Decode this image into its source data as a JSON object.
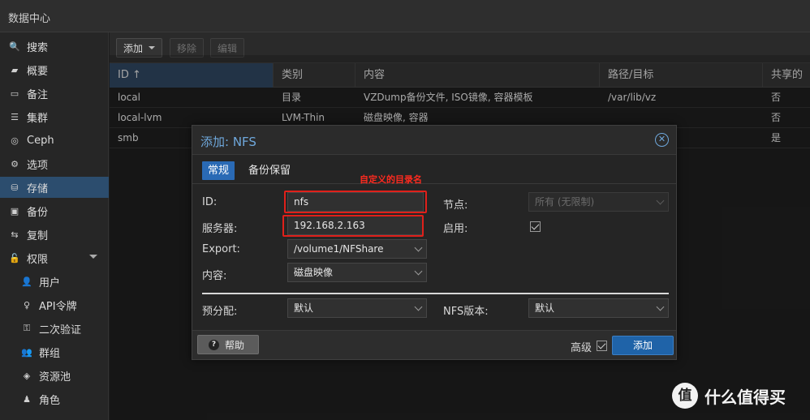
{
  "topbar": {
    "title": "数据中心"
  },
  "sidebar": {
    "items": [
      {
        "label": "搜索",
        "icon": "search-icon",
        "glyph": "🔍"
      },
      {
        "label": "概要",
        "icon": "book-icon",
        "glyph": "▰"
      },
      {
        "label": "备注",
        "icon": "note-icon",
        "glyph": "▭"
      },
      {
        "label": "集群",
        "icon": "server-icon",
        "glyph": "☰"
      },
      {
        "label": "Ceph",
        "icon": "ceph-icon",
        "glyph": "◎"
      },
      {
        "label": "选项",
        "icon": "gear-icon",
        "glyph": "⚙"
      },
      {
        "label": "存储",
        "icon": "database-icon",
        "glyph": "⛁"
      },
      {
        "label": "备份",
        "icon": "floppy-icon",
        "glyph": "▣"
      },
      {
        "label": "复制",
        "icon": "retweet-icon",
        "glyph": "⇆"
      },
      {
        "label": "权限",
        "icon": "unlock-icon",
        "glyph": "🔓"
      },
      {
        "label": "用户",
        "icon": "user-icon",
        "glyph": "👤"
      },
      {
        "label": "API令牌",
        "icon": "token-icon",
        "glyph": "♀"
      },
      {
        "label": "二次验证",
        "icon": "key-icon",
        "glyph": "⚿"
      },
      {
        "label": "群组",
        "icon": "group-icon",
        "glyph": "👥"
      },
      {
        "label": "资源池",
        "icon": "tags-icon",
        "glyph": "◈"
      },
      {
        "label": "角色",
        "icon": "person-icon",
        "glyph": "♟"
      }
    ]
  },
  "toolbar": {
    "add": "添加",
    "remove": "移除",
    "edit": "编辑"
  },
  "grid": {
    "columns": [
      "ID ↑",
      "类别",
      "内容",
      "路径/目标",
      "共享的"
    ],
    "rows": [
      [
        "local",
        "目录",
        "VZDump备份文件, ISO镜像, 容器模板",
        "/var/lib/vz",
        "否"
      ],
      [
        "local-lvm",
        "LVM-Thin",
        "磁盘映像, 容器",
        "",
        "否"
      ],
      [
        "smb",
        "",
        "",
        "",
        "是"
      ]
    ]
  },
  "dialog": {
    "title": "添加: NFS",
    "tabs": [
      "常规",
      "备份保留"
    ],
    "annotation": "自定义的目录名",
    "labels": {
      "id": "ID:",
      "server": "服务器:",
      "export": "Export:",
      "content": "内容:",
      "node": "节点:",
      "enable": "启用:",
      "preallocation": "预分配:",
      "nfs_version": "NFS版本:"
    },
    "values": {
      "id": "nfs",
      "server": "192.168.2.163",
      "export": "/volume1/NFShare",
      "content": "磁盘映像",
      "node": "所有 (无限制)",
      "preallocation": "默认",
      "nfs_version": "默认"
    },
    "footer": {
      "help": "帮助",
      "advanced": "高级",
      "add": "添加"
    }
  },
  "watermark": {
    "logo": "值",
    "text": "什么值得买"
  }
}
